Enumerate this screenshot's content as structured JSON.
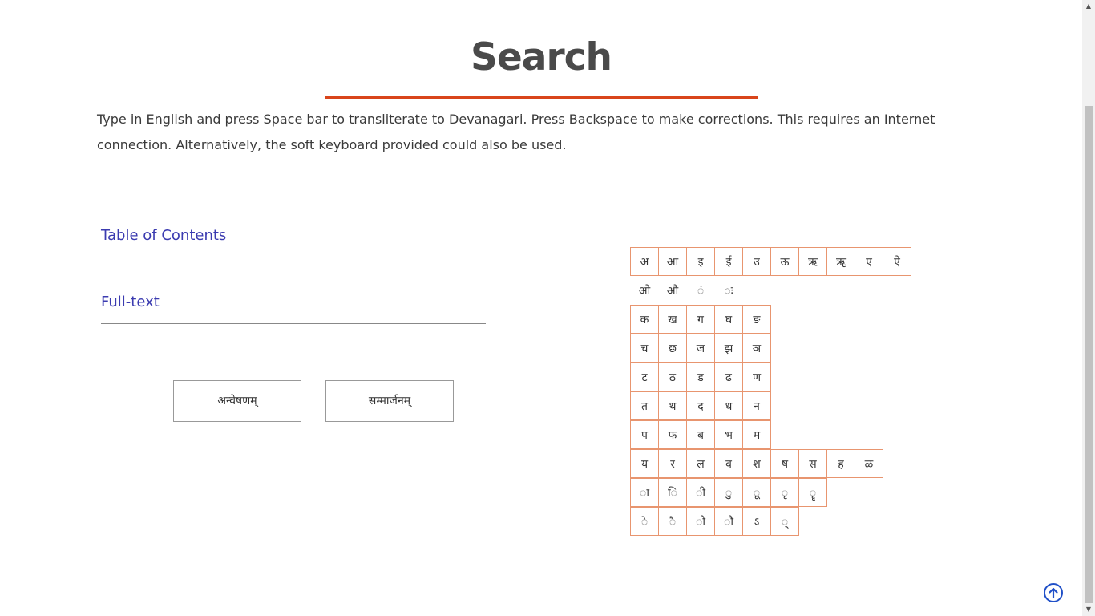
{
  "title": "Search",
  "intro": "Type in English and press Space bar to transliterate to Devanagari. Press Backspace to make corrections. This requires an Internet connection. Alternatively, the soft keyboard provided could also be used.",
  "links": {
    "toc": "Table of Contents",
    "fulltext": "Full-text"
  },
  "buttons": {
    "search": "अन्वेषणम्",
    "reset": "सम्मार्जनम्"
  },
  "keyboard": {
    "rows": [
      [
        "अ",
        "आ",
        "इ",
        "ई",
        "उ",
        "ऊ",
        "ऋ",
        "ॠ",
        "ए",
        "ऐ"
      ],
      [
        "ओ",
        "औ",
        "ं",
        "ः"
      ],
      [
        "क",
        "ख",
        "ग",
        "घ",
        "ङ"
      ],
      [
        "च",
        "छ",
        "ज",
        "झ",
        "ञ"
      ],
      [
        "ट",
        "ठ",
        "ड",
        "ढ",
        "ण"
      ],
      [
        "त",
        "थ",
        "द",
        "ध",
        "न"
      ],
      [
        "प",
        "फ",
        "ब",
        "भ",
        "म"
      ],
      [
        "य",
        "र",
        "ल",
        "व",
        "श",
        "ष",
        "स",
        "ह",
        "ळ"
      ],
      [
        "ा",
        "ि",
        "ी",
        "ु",
        "ू",
        "ृ",
        "ॄ"
      ],
      [
        "े",
        "ै",
        "ो",
        "ौ",
        "ऽ",
        "्"
      ]
    ]
  },
  "colors": {
    "accent": "#d9451b",
    "link": "#3b3bb0",
    "key_border": "#e8956f"
  },
  "icons": {
    "back_to_top": "arrow-up-circle-icon"
  }
}
